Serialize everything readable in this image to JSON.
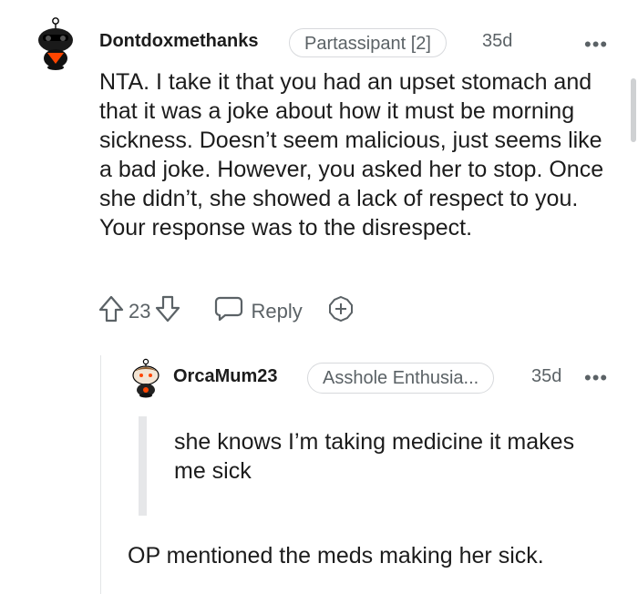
{
  "comment": {
    "username": "Dontdoxmethanks",
    "flair": "Partassipant [2]",
    "age": "35d",
    "more": "•••",
    "body": "NTA. I take it that you had an upset stomach and that it was a joke about how it must be morning sickness. Doesn’t seem malicious, just seems like a bad joke. However, you asked her to stop. Once she didn’t, she showed a lack of respect to you. Your response was to the disrespect.",
    "vote_count": "23",
    "reply_label": "Reply",
    "icons": [
      "upvote-icon",
      "downvote-icon",
      "chat-bubble-icon",
      "award-icon"
    ]
  },
  "reply": {
    "username": "OrcaMum23",
    "flair": "Asshole Enthusia...",
    "age": "35d",
    "more": "•••",
    "quote": "she knows I’m taking medicine it makes me sick",
    "body": "OP mentioned the meds making her sick."
  },
  "colors": {
    "text": "#1c1c1c",
    "meta": "#5b6266",
    "border": "#d7d9dc",
    "avatar_accent": "#ff4500"
  }
}
